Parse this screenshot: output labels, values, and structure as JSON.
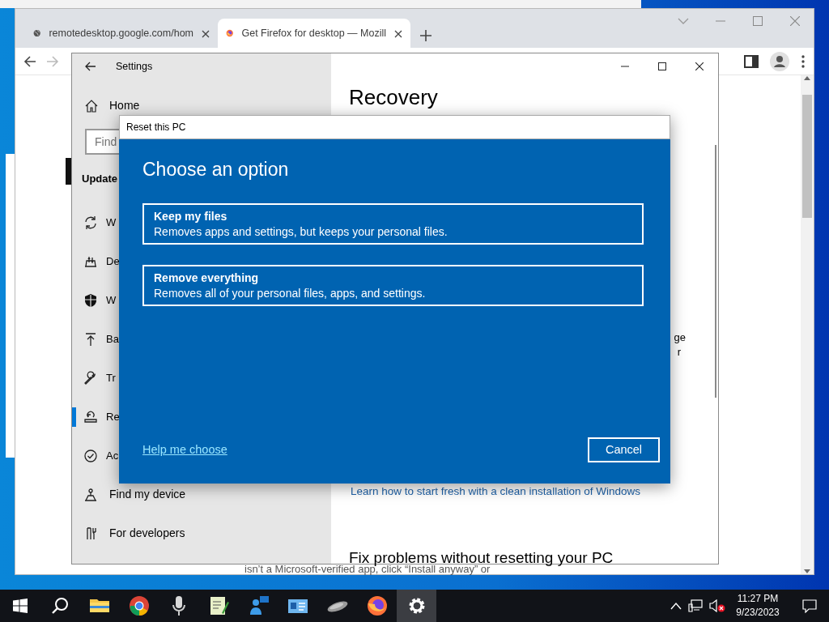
{
  "browser": {
    "tabs": [
      {
        "title": "remotedesktop.google.com/hom",
        "kind": "globe",
        "selected": false
      },
      {
        "title": "Get Firefox for desktop — Mozill",
        "kind": "firefox",
        "selected": true
      }
    ],
    "page_text": "isn’t a Microsoft-verified app, click “Install anyway” or"
  },
  "settings": {
    "title": "Settings",
    "home": "Home",
    "search_placeholder": "Find",
    "section": "Update",
    "items": [
      {
        "label": "W",
        "kind": "sync",
        "selected": false
      },
      {
        "label": "De",
        "kind": "delivery",
        "selected": false
      },
      {
        "label": "W",
        "kind": "shield",
        "selected": false
      },
      {
        "label": "Ba",
        "kind": "backup",
        "selected": false
      },
      {
        "label": "Tr",
        "kind": "wrench",
        "selected": false
      },
      {
        "label": "Re",
        "kind": "recovery",
        "selected": true
      },
      {
        "label": "Ac",
        "kind": "check",
        "selected": false
      },
      {
        "label": "Find my device",
        "kind": "person",
        "selected": false
      },
      {
        "label": "For developers",
        "kind": "tools",
        "selected": false
      }
    ],
    "heading": "Recovery",
    "fragments": [
      "ge",
      "r"
    ],
    "link": "Learn how to start fresh with a clean installation of Windows",
    "section_heading": "Fix problems without resetting your PC"
  },
  "dialog": {
    "title": "Reset this PC",
    "heading": "Choose an option",
    "options": [
      {
        "title": "Keep my files",
        "description": "Removes apps and settings, but keeps your personal files."
      },
      {
        "title": "Remove everything",
        "description": "Removes all of your personal files, apps, and settings."
      }
    ],
    "help_link": "Help me choose",
    "cancel": "Cancel"
  },
  "taskbar": {
    "apps": [
      {
        "kind": "explorer",
        "selected": false
      },
      {
        "kind": "chrome",
        "selected": false
      },
      {
        "kind": "mic",
        "selected": false
      },
      {
        "kind": "notepad",
        "selected": false
      },
      {
        "kind": "people",
        "selected": false
      },
      {
        "kind": "card",
        "selected": false
      },
      {
        "kind": "mouse",
        "selected": false
      },
      {
        "kind": "firefox",
        "selected": false
      },
      {
        "kind": "settings",
        "selected": true
      }
    ],
    "time": "11:27 PM",
    "date": "9/23/2023"
  }
}
